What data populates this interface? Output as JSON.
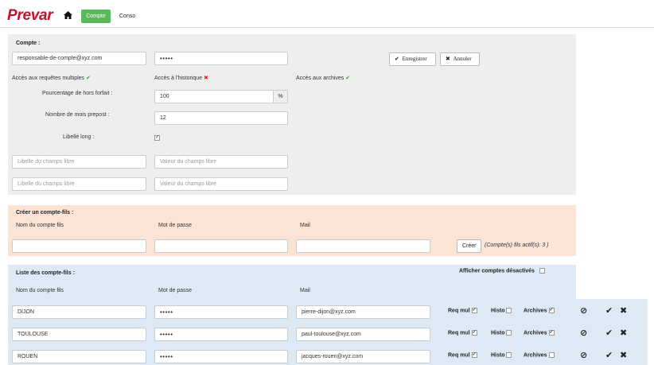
{
  "header": {
    "logo": "Prevar",
    "home_icon": "home-icon",
    "tabs": [
      {
        "label": "Compte"
      },
      {
        "label": "Conso"
      }
    ]
  },
  "account": {
    "section_title": "Compte :",
    "email": "responsable-de-compte@xyz.com",
    "password": "•••••",
    "save_label": "Enregistrer",
    "cancel_label": "Annuler",
    "access_requests": "Accès aux requêtes multiples",
    "access_history": "Accès à l'historique",
    "access_archives": "Accès aux archives",
    "pct_label": "Pourcentage de hors forfait :",
    "pct_value": "100",
    "pct_unit": "%",
    "months_label": "Nombre de mois prepost :",
    "months_value": "12",
    "long_label": "Libellé long :",
    "free_label_ph": "Libelle du champs libre",
    "free_value_ph": "Valeur du champs libre"
  },
  "create": {
    "section_title": "Créer un compte-fils :",
    "col_name": "Nom du compte fils",
    "col_password": "Mot de passe",
    "col_mail": "Mail",
    "create_label": "Créer",
    "active_count": "(Compte(s) fils actif(s): 3 )"
  },
  "list": {
    "section_title": "Liste des compte-fils :",
    "show_disabled": "Afficher comptes désactivés",
    "col_name": "Nom du compte fils",
    "col_password": "Mot de passe",
    "col_mail": "Mail",
    "req_label": "Req mul",
    "histo_label": "Histo",
    "archives_label": "Archives",
    "rows": [
      {
        "name": "DIJON",
        "password": "•••••",
        "mail": "pierre-dijon@xyz.com",
        "req": true,
        "histo": false,
        "archives": true
      },
      {
        "name": "TOULOUSE",
        "password": "•••••",
        "mail": "paul-toulouse@xyz.com",
        "req": true,
        "histo": false,
        "archives": true
      },
      {
        "name": "ROUEN",
        "password": "•••••",
        "mail": "jacques-rouen@xyz.com",
        "req": true,
        "histo": false,
        "archives": false
      }
    ]
  }
}
